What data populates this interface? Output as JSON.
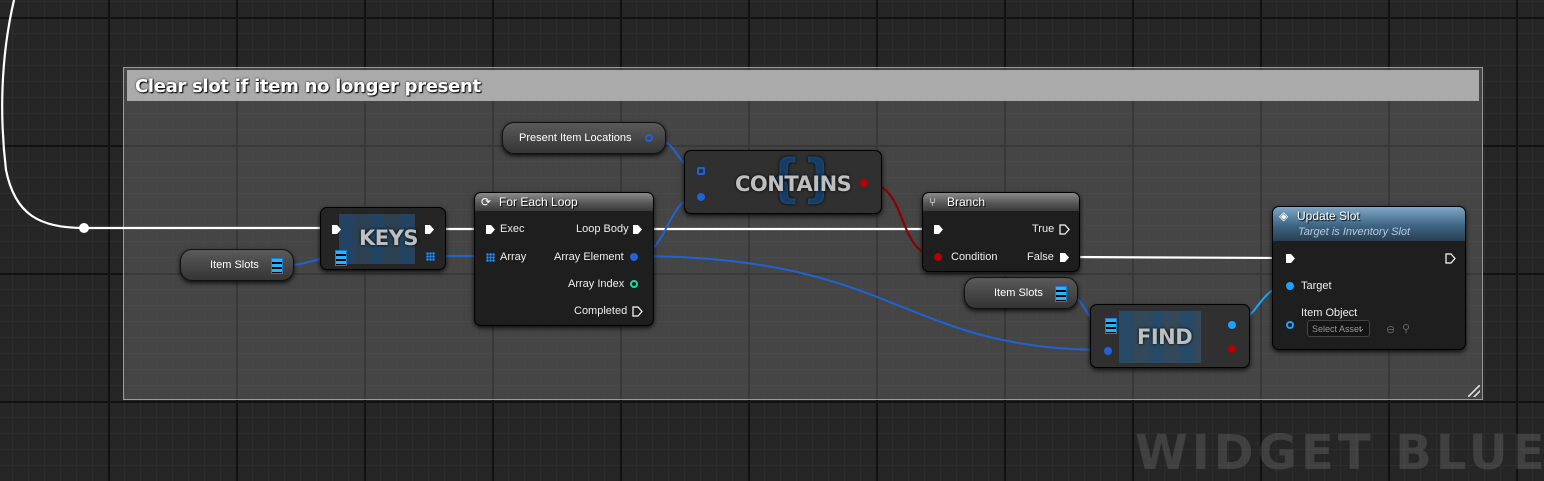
{
  "comment": {
    "title": "Clear slot if item no longer present"
  },
  "nodes": {
    "keys": {
      "title": "KEYS"
    },
    "contains": {
      "title": "CONTAINS"
    },
    "find": {
      "title": "FIND"
    },
    "for_each": {
      "title": "For Each Loop",
      "pins": {
        "exec": "Exec",
        "array": "Array",
        "loop_body": "Loop Body",
        "array_element": "Array Element",
        "array_index": "Array Index",
        "completed": "Completed"
      }
    },
    "branch": {
      "title": "Branch",
      "pins": {
        "condition": "Condition",
        "true": "True",
        "false": "False"
      }
    },
    "update_slot": {
      "title": "Update Slot",
      "subtitle": "Target is Inventory Slot",
      "pins": {
        "target": "Target",
        "item_object": "Item Object"
      },
      "select_asset": "Select Asset"
    }
  },
  "variables": {
    "present_item_locations": "Present Item Locations",
    "item_slots_1": "Item Slots",
    "item_slots_2": "Item Slots"
  },
  "colors": {
    "exec_wire": "#ffffff",
    "data_wire": "#1f63d6",
    "bool_wire": "#8b0000",
    "object_pin": "#1aa3ff",
    "int_pin": "#21d9a0",
    "comment_header": "#aaaaaa"
  },
  "icons": {
    "for_each": "loop-icon",
    "branch": "branch-icon",
    "update_slot": "function-icon"
  },
  "watermark": "WIDGET BLUEPRINT"
}
